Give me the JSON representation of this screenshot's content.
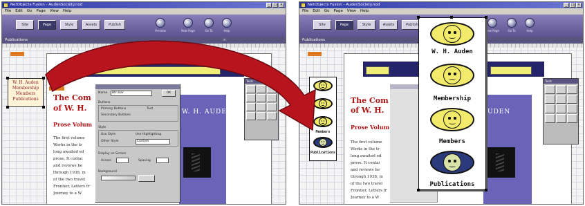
{
  "app": {
    "title": "NetObjects Fusion - AudenSociety.nod",
    "window_buttons": [
      "_",
      "□",
      "×"
    ],
    "menus": [
      "File",
      "Edit",
      "Go",
      "Page",
      "View",
      "Help"
    ],
    "toolbar_buttons": [
      "Site",
      "Page",
      "Style",
      "Assets",
      "Publish"
    ],
    "toolbar_round_buttons": [
      "Preview",
      "New Page",
      "Go To",
      "Help"
    ],
    "section_label": "Publications"
  },
  "left": {
    "selected_text": [
      "W. H. Auden",
      "Membership",
      "Members",
      "Publications"
    ],
    "headline_line1": "The Com",
    "headline_line2": "of W. H.",
    "subhead": "Prose Volum",
    "body_lines": [
      "The first volume",
      "Works in the tr",
      "long awaited ed",
      "prose. It contai",
      "and reviews he",
      "through 1938, m",
      "of the two travel",
      "Frontier, Letters fr",
      "Journey to a W"
    ],
    "page_heading": "W. H. AUDEN",
    "dialog": {
      "name_label": "Name",
      "name_value": "Btn Bar",
      "ok_label": "OK",
      "buttons_label": "Buttons",
      "opt_primary": "Primary Buttons",
      "opt_secondary": "Secondary Buttons",
      "opt_text": "Text",
      "style_label": "Style",
      "use_style": "Use Style",
      "use_highlighting": "Use Highlighting",
      "other_style": "Other Style",
      "other_value": "Custom",
      "display_label": "Display on Screen",
      "across_label": "Across",
      "spacing_label": "Spacing",
      "background_label": "Background"
    },
    "palette_title": "Tools"
  },
  "right": {
    "buttonbar_labels": [
      "W. H. Auden",
      "Membership",
      "Members",
      "Publications"
    ],
    "small_labels": [
      "Members",
      "Publications"
    ],
    "headline_line1": "The Com",
    "headline_line2": "of W. H.",
    "subhead": "Prose Volum",
    "body_lines": [
      "The first volume",
      "Works in the tr",
      "long awaited ed",
      "prose. It contai",
      "and reviews he",
      "through 1938, m",
      "of the two travel",
      "Frontier, Letters fr",
      "Journey to a W"
    ],
    "page_heading": "UDEN",
    "palette_title": "Tools"
  },
  "colors": {
    "arrow": "#b8141e",
    "button_fill": "#f2ea6a",
    "button_blue": "#2a3a7a",
    "navy_panel": "#24246a",
    "toolbar": "#6a6298"
  },
  "icons": [
    "curved-arrow-icon",
    "face-button-icon"
  ]
}
